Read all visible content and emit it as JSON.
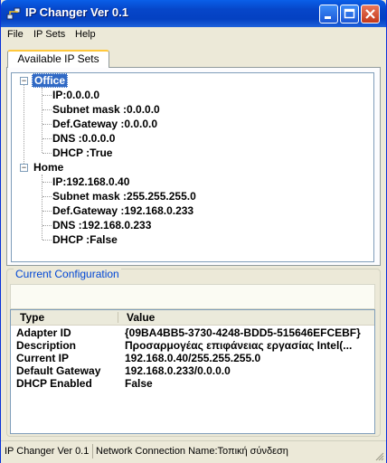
{
  "window": {
    "title": "IP Changer Ver 0.1"
  },
  "menu": [
    {
      "label": "File"
    },
    {
      "label": "IP Sets"
    },
    {
      "label": "Help"
    }
  ],
  "tabs": [
    {
      "label": "Available IP Sets"
    }
  ],
  "tree": {
    "office": {
      "name": "Office",
      "ip": "IP:0.0.0.0",
      "subnet": "Subnet mask :0.0.0.0",
      "gateway": "Def.Gateway :0.0.0.0",
      "dns": "DNS :0.0.0.0",
      "dhcp": "DHCP :True"
    },
    "home": {
      "name": "Home",
      "ip": "IP:192.168.0.40",
      "subnet": "Subnet mask :255.255.255.0",
      "gateway": "Def.Gateway :192.168.0.233",
      "dns": "DNS :192.168.0.233",
      "dhcp": "DHCP :False"
    }
  },
  "current_config": {
    "title": "Current Configuration",
    "columns": {
      "type": "Type",
      "value": "Value"
    },
    "rows": [
      {
        "type": "Adapter ID",
        "value": "{09BA4BB5-3730-4248-BDD5-515646EFCEBF}"
      },
      {
        "type": "Description",
        "value": "Προσαρμογέας επιφάνειας εργασίας Intel(..."
      },
      {
        "type": "Current IP",
        "value": "192.168.0.40/255.255.255.0"
      },
      {
        "type": "Default Gateway",
        "value": "192.168.0.233/0.0.0.0"
      },
      {
        "type": "DHCP Enabled",
        "value": "False"
      }
    ]
  },
  "status": {
    "app": "IP Changer Ver 0.1",
    "connection": "Network Connection Name:Τοπική σύνδεση"
  }
}
